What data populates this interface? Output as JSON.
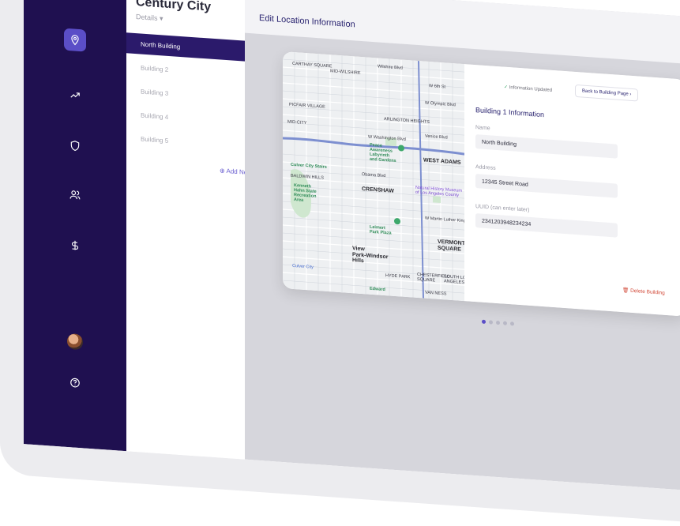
{
  "site": {
    "title": "Century City",
    "subtitle": "Details"
  },
  "nav_icons": [
    "location-pin-icon",
    "trending-up-icon",
    "shield-icon",
    "users-icon",
    "dollar-icon",
    "avatar",
    "help-icon"
  ],
  "buildings": [
    {
      "label": "North Building",
      "active": true
    },
    {
      "label": "Building 2",
      "active": false
    },
    {
      "label": "Building 3",
      "active": false
    },
    {
      "label": "Building 4",
      "active": false
    },
    {
      "label": "Building 5",
      "active": false
    }
  ],
  "add_new": "Add New",
  "page": {
    "title": "Edit Location Information"
  },
  "form": {
    "status": "Information Updated",
    "back_button": "Back to Building Page",
    "heading": "Building 1 Information",
    "name_label": "Name",
    "name_value": "North Building",
    "address_label": "Address",
    "address_value": "12345 Street Road",
    "uuid_label": "UUID  (can enter later)",
    "uuid_value": "2341203948234234",
    "delete": "Delete Building"
  },
  "map": {
    "labels": {
      "carthay": "CARTHAY\nSQUARE",
      "mid_wilshire": "MID-WILSHIRE",
      "wilshire": "Wilshire Blvd",
      "w6th": "W 6th St",
      "olympic": "W Olympic Blvd",
      "pico": "PICFAIR VILLAGE",
      "arlington": "ARLINGTON\nHEIGHTS",
      "venice": "Venice Blvd",
      "midcity": "MID-CITY",
      "washington": "W Washington Blvd",
      "peace": "Peace\nAwareness\nLabyrinth\nand Gardens",
      "west_adams": "WEST ADAMS",
      "culver_stairs": "Culver City Stairs",
      "baldwin": "BALDWIN HILLS",
      "obama": "Obama Blvd",
      "crenshaw": "CRENSHAW",
      "natural_history": "Natural History Museum\nof Los Angeles County",
      "kenneth": "Kenneth\nHahn State\nRecreation\nArea",
      "mlk": "W Martin Luther King Jr Blvd",
      "leimert": "Leimert\nPark Plaza",
      "vermont": "VERMONT\nSQUARE",
      "view_park": "View\nPark-Windsor\nHills",
      "culver_city": "Culver City",
      "hyde_park": "HYDE PARK",
      "chesterfield": "CHESTERFIELD\nSQUARE",
      "south_la": "SOUTH LO\nANGELES",
      "van_ness": "VAN NESS",
      "edward": "Edward"
    }
  },
  "pagination": {
    "count": 5,
    "active": 0
  }
}
